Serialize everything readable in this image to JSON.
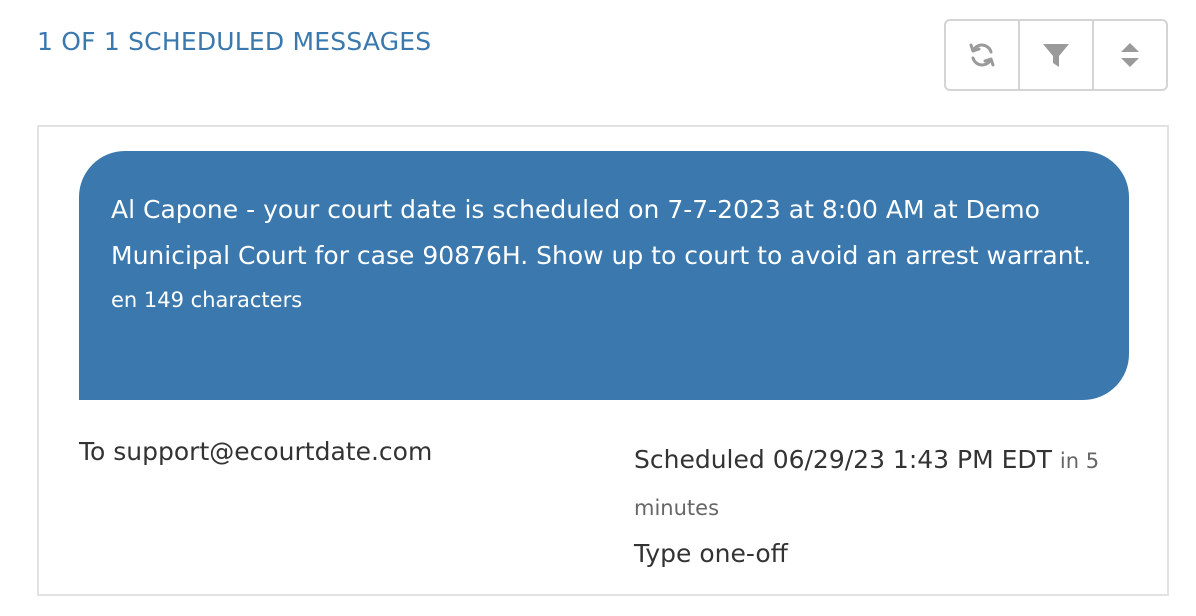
{
  "header": {
    "title": "1 OF 1 SCHEDULED MESSAGES"
  },
  "toolbar": {
    "buttons": [
      {
        "icon": "refresh-icon"
      },
      {
        "icon": "filter-icon"
      },
      {
        "icon": "sort-icon"
      }
    ]
  },
  "message": {
    "text": "Al Capone - your court date is scheduled on 7-7-2023 at 8:00 AM at Demo Municipal Court for case 90876H. Show up to court to avoid an arrest warrant.",
    "meta": "en 149 characters",
    "bubble_color": "#3a78ad",
    "to_line": "To support@ecourtdate.com",
    "scheduled_label": "Scheduled 06/29/23 1:43 PM EDT",
    "scheduled_relative": "in 5 minutes",
    "type_line": "Type one-off"
  },
  "colors": {
    "accent": "#3a78ad"
  }
}
